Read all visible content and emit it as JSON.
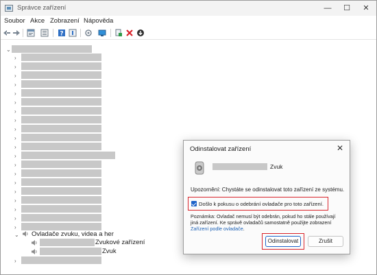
{
  "window": {
    "title": "Správce zařízení",
    "controls": {
      "minimize": "—",
      "maximize": "☐",
      "close": "✕"
    }
  },
  "menubar": {
    "items": [
      "Soubor",
      "Akce",
      "Zobrazení",
      "Nápověda"
    ]
  },
  "toolbar": {
    "icons": [
      "back-arrow-icon",
      "forward-arrow-icon",
      "properties-icon",
      "show-hidden-icon",
      "help-icon",
      "driver-info-icon",
      "scan-hardware-icon",
      "monitor-icon",
      "update-driver-icon",
      "uninstall-icon",
      "download-icon"
    ]
  },
  "tree": {
    "expanded_category": "Ovladače zvuku, videa a her",
    "expanded_children": [
      {
        "suffix": "Zvukové zařízení"
      },
      {
        "suffix": "Zvuk"
      }
    ]
  },
  "dialog": {
    "title": "Odinstalovat zařízení",
    "close": "✕",
    "device_suffix": "Zvuk",
    "warning": "Upozornění: Chystáte se odinstalovat toto zařízení ze systému.",
    "checkbox_label": "Došlo k pokusu o odebrání ovladače pro toto zařízení.",
    "checkbox_checked": true,
    "note_text": "Poznámka: Ovladač nemusí být odebrán, pokud ho stále používají jiná zařízení. Ke správě ovladačů samostatně použijte zobrazení ",
    "note_link": "Zařízení podle ovladače",
    "note_end": ".",
    "primary_button": "Odinstalovat",
    "secondary_button": "Zrušit",
    "highlight_color": "#d9232a",
    "accent_color": "#1e63c9"
  }
}
